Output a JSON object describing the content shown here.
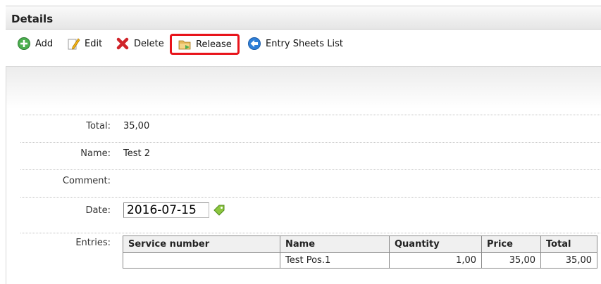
{
  "header": {
    "title": "Details"
  },
  "toolbar": {
    "add_label": "Add",
    "edit_label": "Edit",
    "delete_label": "Delete",
    "release_label": "Release",
    "entry_sheets_label": "Entry Sheets List"
  },
  "form": {
    "total_label": "Total:",
    "total_value": "35,00",
    "name_label": "Name:",
    "name_value": "Test 2",
    "comment_label": "Comment:",
    "comment_value": "",
    "date_label": "Date:",
    "date_value": "2016-07-15",
    "entries_label": "Entries:"
  },
  "entries": {
    "columns": [
      "Service number",
      "Name",
      "Quantity",
      "Price",
      "Total"
    ],
    "rows": [
      {
        "service_number": "",
        "name": "Test Pos.1",
        "quantity": "1,00",
        "price": "35,00",
        "total": "35,00"
      }
    ]
  },
  "colors": {
    "highlight": "#e8141b",
    "add": "#4caf50",
    "delete": "#d0242a",
    "nav": "#2f7fd8"
  }
}
